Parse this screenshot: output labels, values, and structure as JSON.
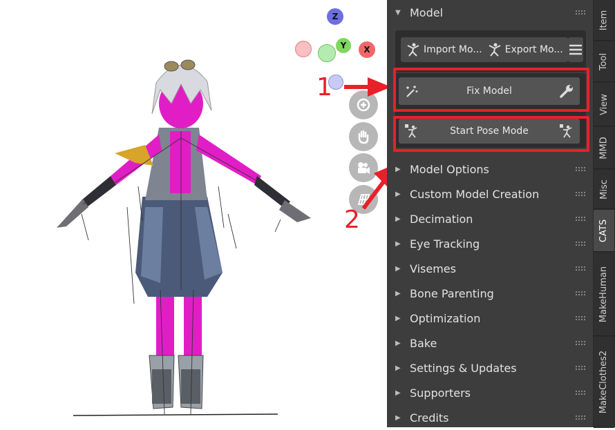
{
  "panel": {
    "model_header": "Model",
    "import_label": "Import Mo...",
    "export_label": "Export Mo...",
    "fix_model_label": "Fix Model",
    "start_pose_label": "Start Pose Mode",
    "sections": [
      "Model Options",
      "Custom Model Creation",
      "Decimation",
      "Eye Tracking",
      "Visemes",
      "Bone Parenting",
      "Optimization",
      "Bake",
      "Settings & Updates",
      "Supporters",
      "Credits"
    ]
  },
  "tabs": [
    "Item",
    "Tool",
    "View",
    "MMD",
    "Misc",
    "CATS",
    "MakeHuman",
    "MakeClothes2"
  ],
  "active_tab": "CATS",
  "gizmo": {
    "z": "Z",
    "y": "Y",
    "x": "X"
  },
  "annotations": {
    "step1": "1",
    "step2": "2"
  },
  "colors": {
    "panel_bg": "#3d3d3d",
    "button_bg": "#545454",
    "highlight_red": "#e8202a",
    "model_magenta": "#e11ec6"
  }
}
